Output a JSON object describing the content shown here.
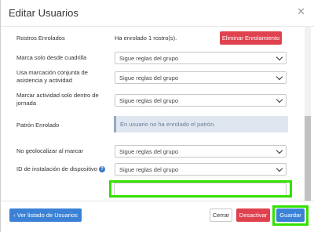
{
  "modal": {
    "title": "Editar Usuarios",
    "close_icon": "close-icon"
  },
  "form": {
    "rostros": {
      "label": "Rostros Enrolados",
      "value": "Ha enrolado 1 rostro(s).",
      "button": "Eliminar Enrolamiento"
    },
    "marca_cuadrilla": {
      "label": "Marca solo desde cuadrilla",
      "value": "Sigue reglas del grupo"
    },
    "marcacion_conjunta": {
      "label": "Usa marcación conjunta de asistencia y actividad",
      "value": "Sigue reglas del grupo"
    },
    "marcar_actividad": {
      "label": "Marcar actividad solo dentro de jornada",
      "value": "Sigue reglas del grupo"
    },
    "patron": {
      "label": "Patrón Enrolado",
      "info": "En usuario no ha enrolado el patrón."
    },
    "no_geolocalizar": {
      "label": "No geolocalizar al marcar",
      "value": "Sigue reglas del grupo"
    },
    "id_instalacion": {
      "label": "ID de instalación de dispositivo",
      "help_icon": "help-circle-icon",
      "value": "Sigue reglas del grupo"
    },
    "extra_input": {
      "value": ""
    }
  },
  "footer": {
    "back_label": "Ver listado de Usuarios",
    "back_icon": "chevron-left-icon",
    "close_label": "Cerrar",
    "deactivate_label": "Desactivar",
    "save_label": "Guardar"
  },
  "colors": {
    "primary": "#3b82d6",
    "danger": "#e0414f",
    "highlight": "#33e000",
    "info_bg": "#dfe6f0"
  }
}
